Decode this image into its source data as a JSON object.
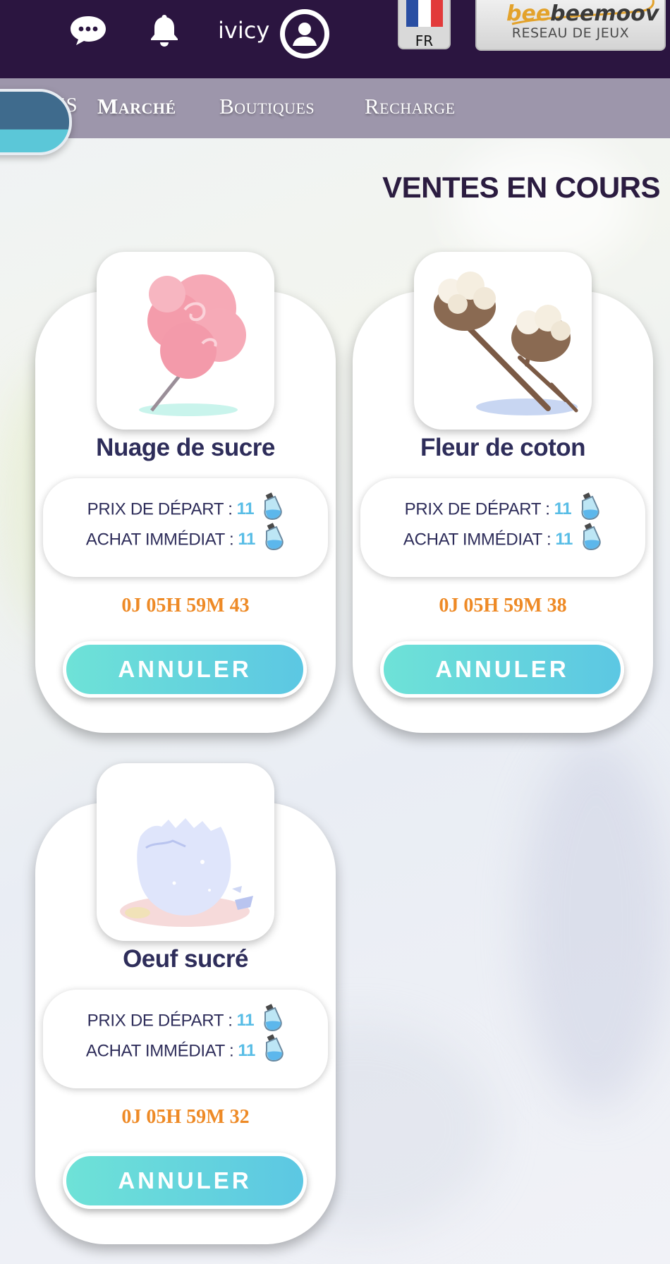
{
  "header": {
    "username": "ivicy",
    "language_label": "FR",
    "partner_logo": {
      "brand": "beemoov",
      "tagline": "RESEAU DE JEUX"
    },
    "icons": [
      "chat-icon",
      "bell-icon",
      "avatar-icon",
      "flag-fr-icon"
    ]
  },
  "nav": {
    "partial_left": "QUÊTES",
    "items": [
      {
        "label": "Marché",
        "active": true
      },
      {
        "label": "Boutiques",
        "active": false
      },
      {
        "label": "Recharge",
        "active": false
      }
    ]
  },
  "section_title": "VENTES EN COURS",
  "labels": {
    "start_price": "PRIX DE DÉPART :",
    "buy_now": "ACHAT IMMÉDIAT :",
    "cancel": "ANNULER"
  },
  "sales": [
    {
      "name": "Nuage de sucre",
      "start_price": "11",
      "buy_now": "11",
      "timer": "0J 05H 59M 43",
      "image": "cotton-candy-icon"
    },
    {
      "name": "Fleur de coton",
      "start_price": "11",
      "buy_now": "11",
      "timer": "0J 05H 59M 38",
      "image": "cotton-flower-icon"
    },
    {
      "name": "Oeuf sucré",
      "start_price": "11",
      "buy_now": "11",
      "timer": "0J 05H 59M 32",
      "image": "sugar-egg-icon"
    }
  ],
  "colors": {
    "topbar": "#2b1540",
    "navbar": "#9d96ab",
    "title": "#2b1c40",
    "price_value": "#58bde6",
    "timer": "#ee8a26",
    "button_start": "#6ee2d7",
    "button_end": "#5cc7e3"
  }
}
